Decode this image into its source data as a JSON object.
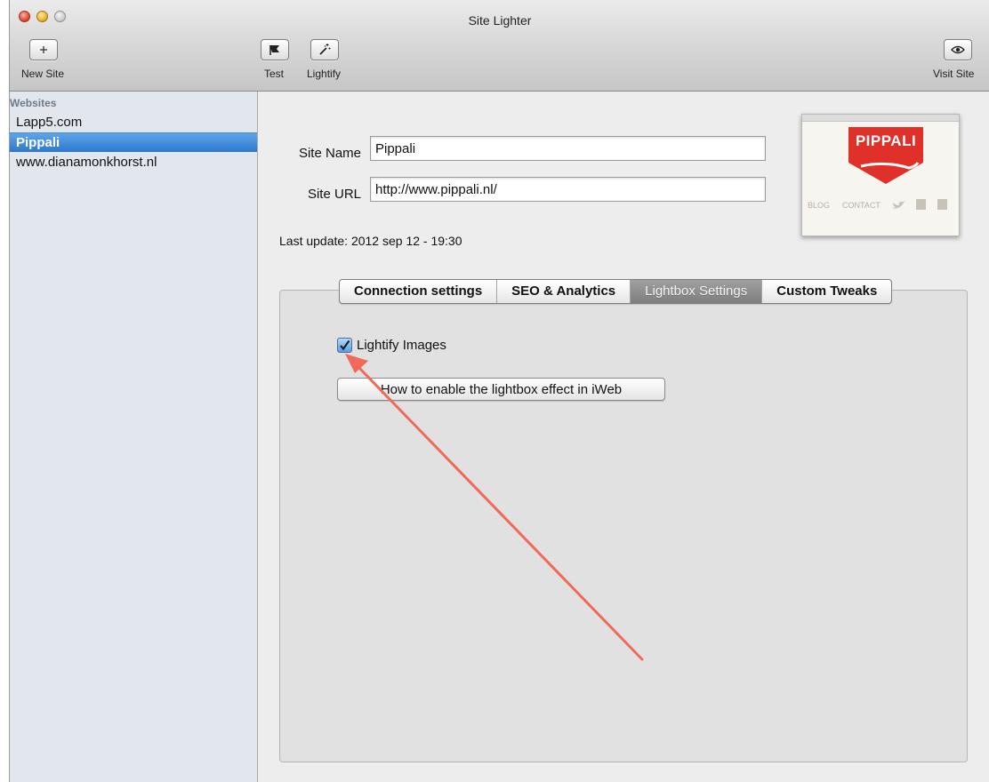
{
  "window": {
    "title": "Site Lighter"
  },
  "toolbar": {
    "new_site_label": "New Site",
    "test_label": "Test",
    "lightify_label": "Lightify",
    "visit_site_label": "Visit Site"
  },
  "sidebar": {
    "header": "Websites",
    "items": [
      {
        "label": "Lapp5.com",
        "selected": false
      },
      {
        "label": "Pippali",
        "selected": true
      },
      {
        "label": "www.dianamonkhorst.nl",
        "selected": false
      }
    ]
  },
  "site": {
    "name_label": "Site Name",
    "name_value": "Pippali",
    "url_label": "Site URL",
    "url_value": "http://www.pippali.nl/",
    "last_update": "Last update: 2012 sep 12 - 19:30"
  },
  "thumbnail": {
    "brand": "PIPPALI",
    "nav_blog": "BLOG",
    "nav_contact": "CONTACT"
  },
  "tabs": [
    {
      "label": "Connection settings",
      "active": false
    },
    {
      "label": "SEO & Analytics",
      "active": false
    },
    {
      "label": "Lightbox Settings",
      "active": true
    },
    {
      "label": "Custom Tweaks",
      "active": false
    }
  ],
  "lightbox": {
    "checkbox_label": "Lightify Images",
    "checked": true,
    "help_button_label": "How to enable the lightbox effect in iWeb"
  },
  "colors": {
    "accent": "#3a86d6",
    "annotation_arrow": "#f0695a",
    "brand_red": "#e0302a"
  }
}
